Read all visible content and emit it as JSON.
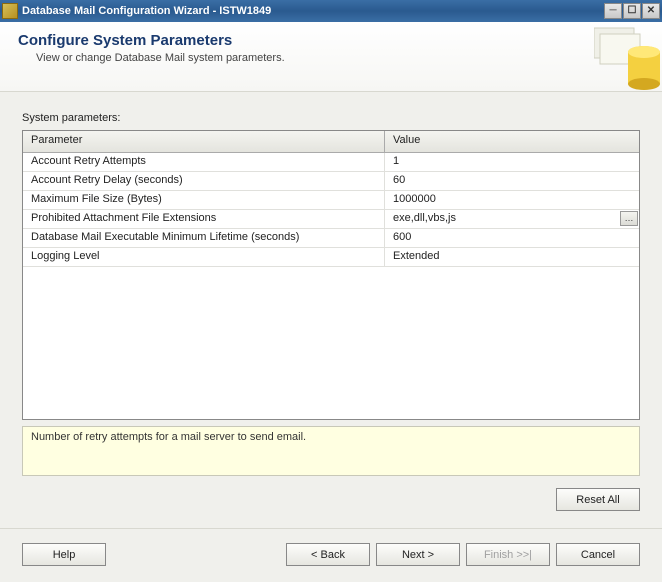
{
  "window": {
    "title": "Database Mail Configuration Wizard - ISTW1849"
  },
  "header": {
    "title": "Configure System Parameters",
    "subtitle": "View or change Database Mail system parameters."
  },
  "labels": {
    "system_parameters": "System parameters:"
  },
  "grid": {
    "headers": {
      "param": "Parameter",
      "value": "Value"
    },
    "rows": [
      {
        "param": "Account Retry Attempts",
        "value": "1"
      },
      {
        "param": "Account Retry Delay (seconds)",
        "value": "60"
      },
      {
        "param": "Maximum File Size (Bytes)",
        "value": "1000000"
      },
      {
        "param": "Prohibited Attachment File Extensions",
        "value": "exe,dll,vbs,js",
        "has_ellipsis": true
      },
      {
        "param": "Database Mail Executable Minimum Lifetime (seconds)",
        "value": "600"
      },
      {
        "param": "Logging Level",
        "value": "Extended"
      }
    ]
  },
  "description": "Number of retry attempts for a mail server to send email.",
  "buttons": {
    "reset_all": "Reset All",
    "help": "Help",
    "back": "< Back",
    "next": "Next >",
    "finish": "Finish >>|",
    "cancel": "Cancel"
  }
}
